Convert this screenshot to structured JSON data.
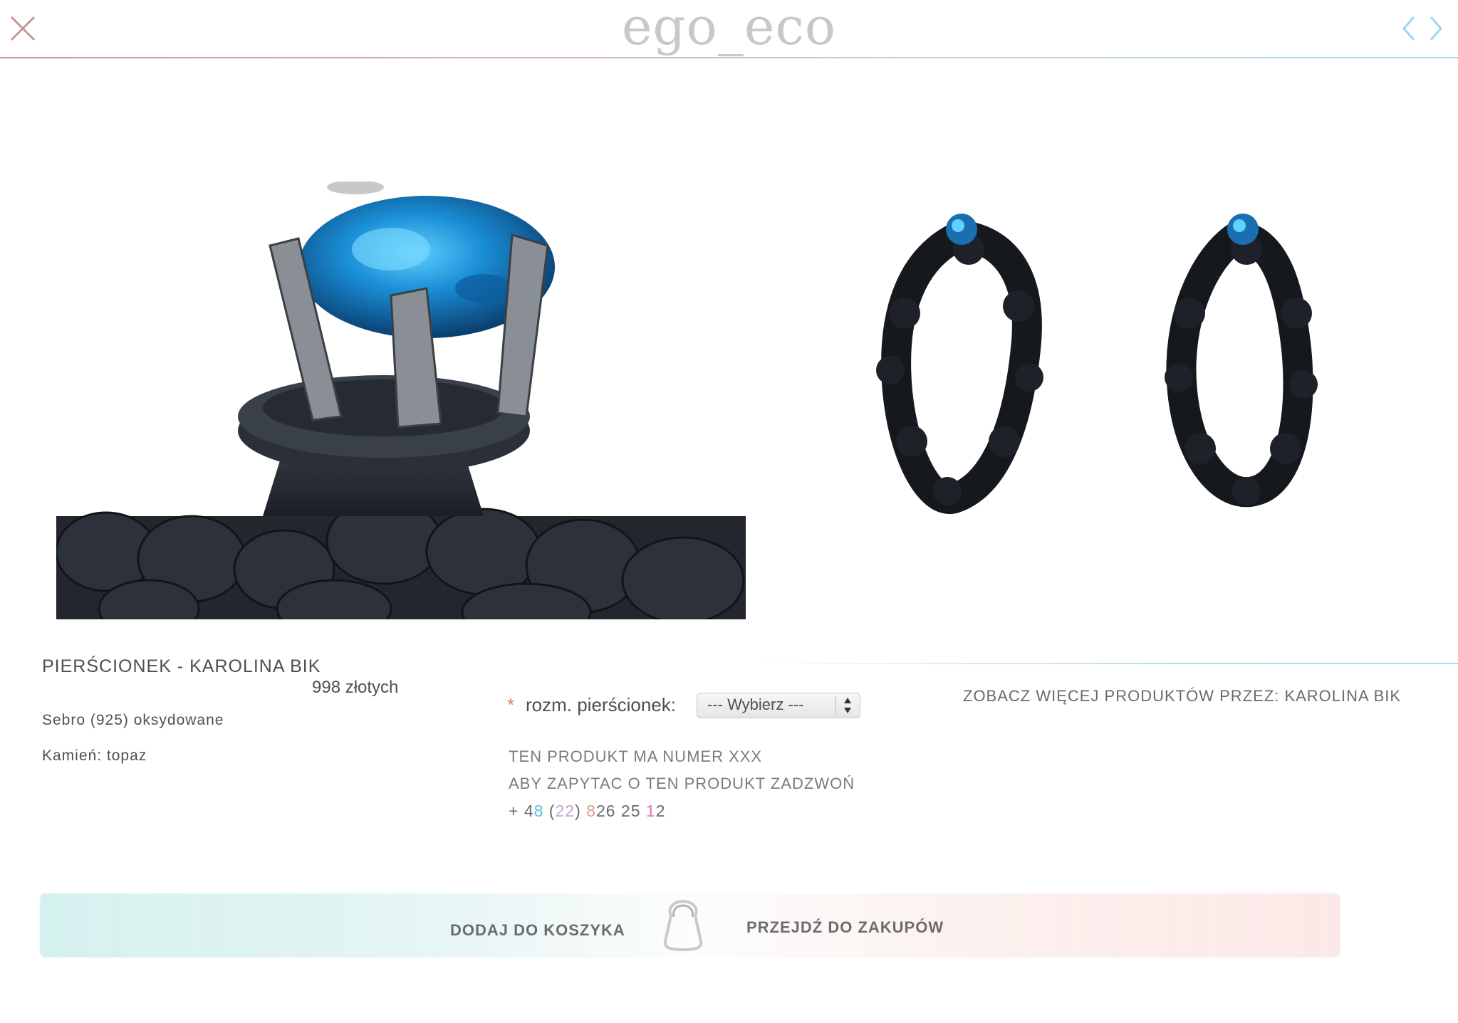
{
  "header": {
    "logo": "ego_eco",
    "close_icon": "close-icon",
    "prev_icon": "chevron-left-icon",
    "next_icon": "chevron-right-icon"
  },
  "product": {
    "title": "PIERŚCIONEK - KAROLINA BIK",
    "price": "998 złotych",
    "material": "Sebro (925) oksydowane",
    "stone": "Kamień: topaz"
  },
  "size": {
    "required_mark": "*",
    "label": "rozm. pierścionek:",
    "selected": "--- Wybierz ---"
  },
  "more_products": "ZOBACZ WIĘCEJ PRODUKTÓW PRZEZ: KAROLINA BIK",
  "contact": {
    "product_number": "TEN PRODUKT MA NUMER XXX",
    "ask": "ABY ZAPYTAC O TEN PRODUKT ZADZWOŃ",
    "phone_parts": [
      "+ 4",
      "8",
      " (",
      "22",
      ") ",
      "8",
      "26 25 ",
      "1",
      "2"
    ]
  },
  "cart": {
    "add_label": "DODAJ DO KOSZYKA",
    "checkout_label": "PRZEJDŹ DO ZAKUPÓW",
    "bag_icon": "shopping-bag-icon"
  },
  "colors": {
    "accent_close": "#c7958f",
    "accent_nav": "#9fd6ef",
    "required": "#d9806e",
    "topaz": "#1a8ed6"
  }
}
